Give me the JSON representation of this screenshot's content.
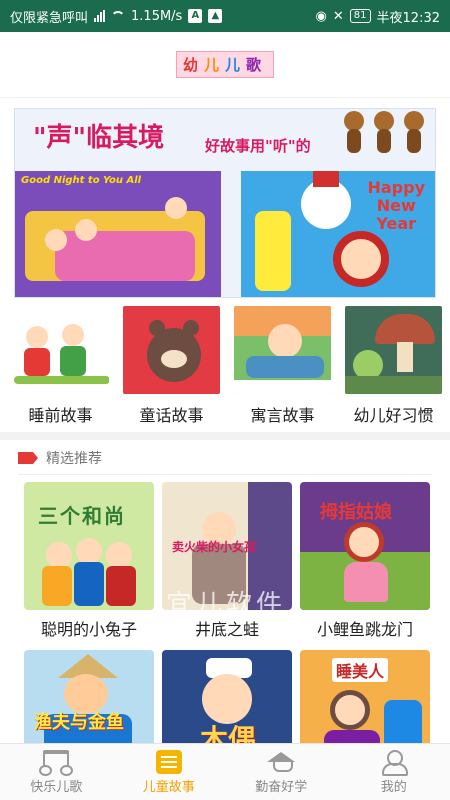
{
  "status_bar": {
    "carrier": "仅限紧急呼叫",
    "speed": "1.15M/s",
    "battery": "81",
    "time": "半夜12:32"
  },
  "header": {
    "logo_chars": [
      "幼",
      "儿",
      "儿",
      "歌"
    ]
  },
  "banner": {
    "title": "\"声\"临其境",
    "subtitle": "好故事用\"听\"的",
    "left_caption": "Good Night to You All",
    "right_caption_line1": "Happy",
    "right_caption_line2": "New",
    "right_caption_line3": "Year"
  },
  "categories": [
    {
      "label": "睡前故事"
    },
    {
      "label": "童话故事"
    },
    {
      "label": "寓言故事"
    },
    {
      "label": "幼儿好习惯"
    }
  ],
  "section": {
    "title": "精选推荐"
  },
  "stories": [
    {
      "label": "聪明的小兔子",
      "cover_text": "三个和尚"
    },
    {
      "label": "井底之蛙",
      "cover_text": "卖火柴的小女孩"
    },
    {
      "label": "小鲤鱼跳龙门",
      "cover_text": "拇指姑娘"
    },
    {
      "label": "",
      "cover_text": "渔夫与金鱼"
    },
    {
      "label": "",
      "cover_text": "木偶"
    },
    {
      "label": "",
      "cover_text": "睡美人"
    }
  ],
  "watermark": "宜儿软件",
  "nav": [
    {
      "label": "快乐儿歌",
      "icon": "music-note-icon",
      "active": false
    },
    {
      "label": "儿童故事",
      "icon": "book-icon",
      "active": true
    },
    {
      "label": "勤奋好学",
      "icon": "graduation-cap-icon",
      "active": false
    },
    {
      "label": "我的",
      "icon": "user-icon",
      "active": false
    }
  ],
  "colors": {
    "accent": "#f2a100",
    "status_bar": "#1b6b4e",
    "banner_red": "#d81b60"
  }
}
